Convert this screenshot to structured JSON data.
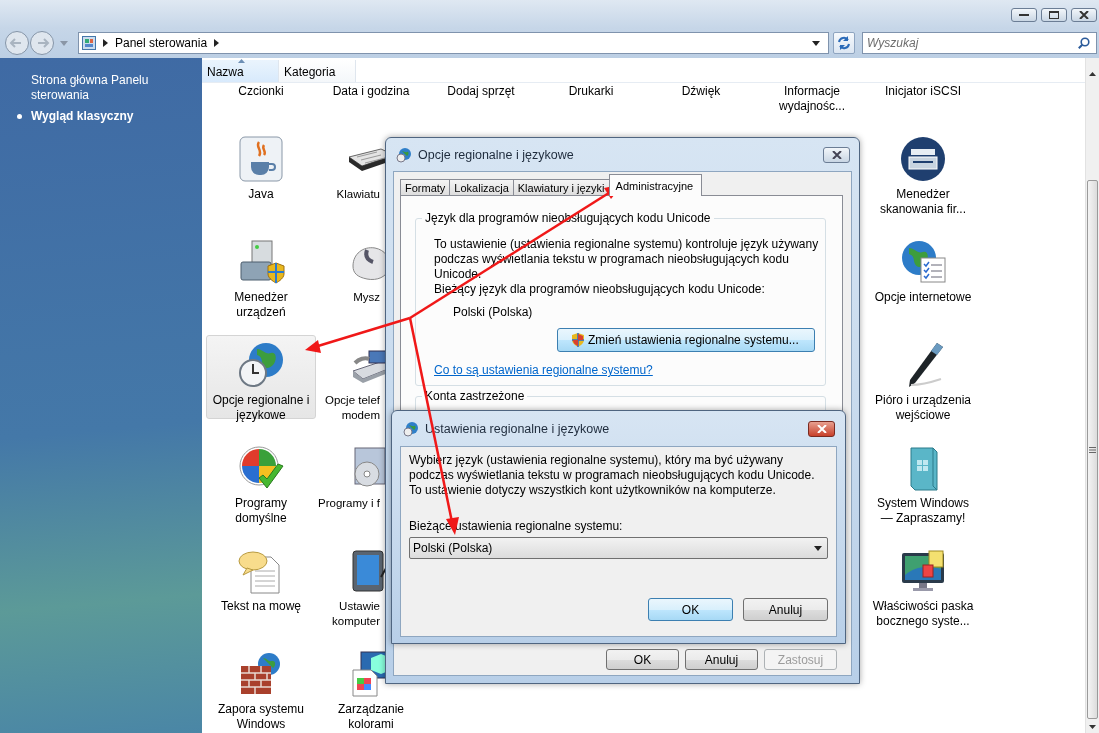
{
  "address_bar": {
    "breadcrumb": "Panel sterowania"
  },
  "search": {
    "placeholder": "Wyszukaj"
  },
  "sidebar": {
    "items": [
      {
        "label": "Strona główna Panelu sterowania",
        "selected": false
      },
      {
        "label": "Wygląd klasyczny",
        "selected": true
      }
    ]
  },
  "list_header": [
    {
      "label": "Nazwa",
      "sorted": true
    },
    {
      "label": "Kategoria",
      "sorted": false
    }
  ],
  "icon_columns": [
    [
      {
        "label": "Czcionki",
        "selected": false,
        "clipped": false
      },
      {
        "label": "Java",
        "selected": false,
        "clipped": false
      },
      {
        "label": "Menedżer urządzeń",
        "selected": false,
        "clipped": false
      },
      {
        "label": "Opcje regionalne i językowe",
        "selected": true,
        "clipped": false
      },
      {
        "label": "Programy domyślne",
        "selected": false,
        "clipped": false
      },
      {
        "label": "Tekst na mowę",
        "selected": false,
        "clipped": false
      },
      {
        "label": "Zapora systemu Windows",
        "selected": false,
        "clipped": false
      }
    ],
    [
      {
        "label": "Data i godzina",
        "selected": false,
        "clipped": false
      },
      {
        "label": "Klawiatu",
        "selected": false,
        "clipped": true
      },
      {
        "label": "Mysz",
        "selected": false,
        "clipped": true
      },
      {
        "label": "Opcje telef\nmodem",
        "selected": false,
        "clipped": true
      },
      {
        "label": "Programy i f",
        "selected": false,
        "clipped": true
      },
      {
        "label": "Ustawie\nkomputer",
        "selected": false,
        "clipped": true
      },
      {
        "label": "Zarządzanie kolorami",
        "selected": false,
        "clipped": false
      }
    ],
    [
      {
        "label": "Dodaj sprzęt",
        "selected": false,
        "clipped": false
      }
    ],
    [
      {
        "label": "Drukarki",
        "selected": false,
        "clipped": false
      }
    ],
    [
      {
        "label": "Dźwięk",
        "selected": false,
        "clipped": false
      }
    ],
    [
      {
        "label": "Informacje wydajnośc...",
        "selected": false,
        "clipped": false
      }
    ],
    [
      {
        "label": "Inicjator iSCSI",
        "selected": false,
        "clipped": false
      },
      {
        "label": "Menedżer skanowania fir...",
        "selected": false,
        "clipped": false
      },
      {
        "label": "Opcje internetowe",
        "selected": false,
        "clipped": false
      },
      {
        "label": "Pióro i urządzenia wejściowe",
        "selected": false,
        "clipped": false
      },
      {
        "label": "System Windows — Zapraszamy!",
        "selected": false,
        "clipped": false
      },
      {
        "label": "Właściwości paska bocznego syste...",
        "selected": false,
        "clipped": false
      }
    ]
  ],
  "dialog_options": {
    "title": "Opcje regionalne i językowe",
    "tabs": [
      {
        "label": "Formaty",
        "selected": false
      },
      {
        "label": "Lokalizacja",
        "selected": false
      },
      {
        "label": "Klawiatury i języki",
        "selected": false
      },
      {
        "label": "Administracyjne",
        "selected": true
      }
    ],
    "unicode_group": {
      "legend": "Język dla programów nieobsługujących kodu Unicode",
      "description": "To ustawienie (ustawienia regionalne systemu) kontroluje język używany podczas wyświetlania tekstu w programach nieobsługujących kodu Unicode.",
      "current_label": "Bieżący język dla programów nieobsługujących kodu Unicode:",
      "current_value": "Polski (Polska)",
      "change_button": "Zmień ustawienia regionalne systemu...",
      "help_link": "Co to są ustawienia regionalne systemu?"
    },
    "accounts_group": {
      "legend": "Konta zastrzeżone"
    },
    "buttons": [
      {
        "label": "OK",
        "disabled": false
      },
      {
        "label": "Anuluj",
        "disabled": false
      },
      {
        "label": "Zastosuj",
        "disabled": true
      }
    ]
  },
  "dialog_locale": {
    "title": "Ustawienia regionalne i językowe",
    "description": "Wybierz język (ustawienia regionalne systemu), który ma być używany podczas wyświetlania tekstu w programach nieobsługujących kodu Unicode. To ustawienie dotyczy wszystkich kont użytkowników na komputerze.",
    "select_label": "Bieżące ustawienia regionalne systemu:",
    "select_value": "Polski (Polska)",
    "buttons": [
      {
        "label": "OK",
        "default": true
      },
      {
        "label": "Anuluj",
        "default": false
      }
    ]
  }
}
